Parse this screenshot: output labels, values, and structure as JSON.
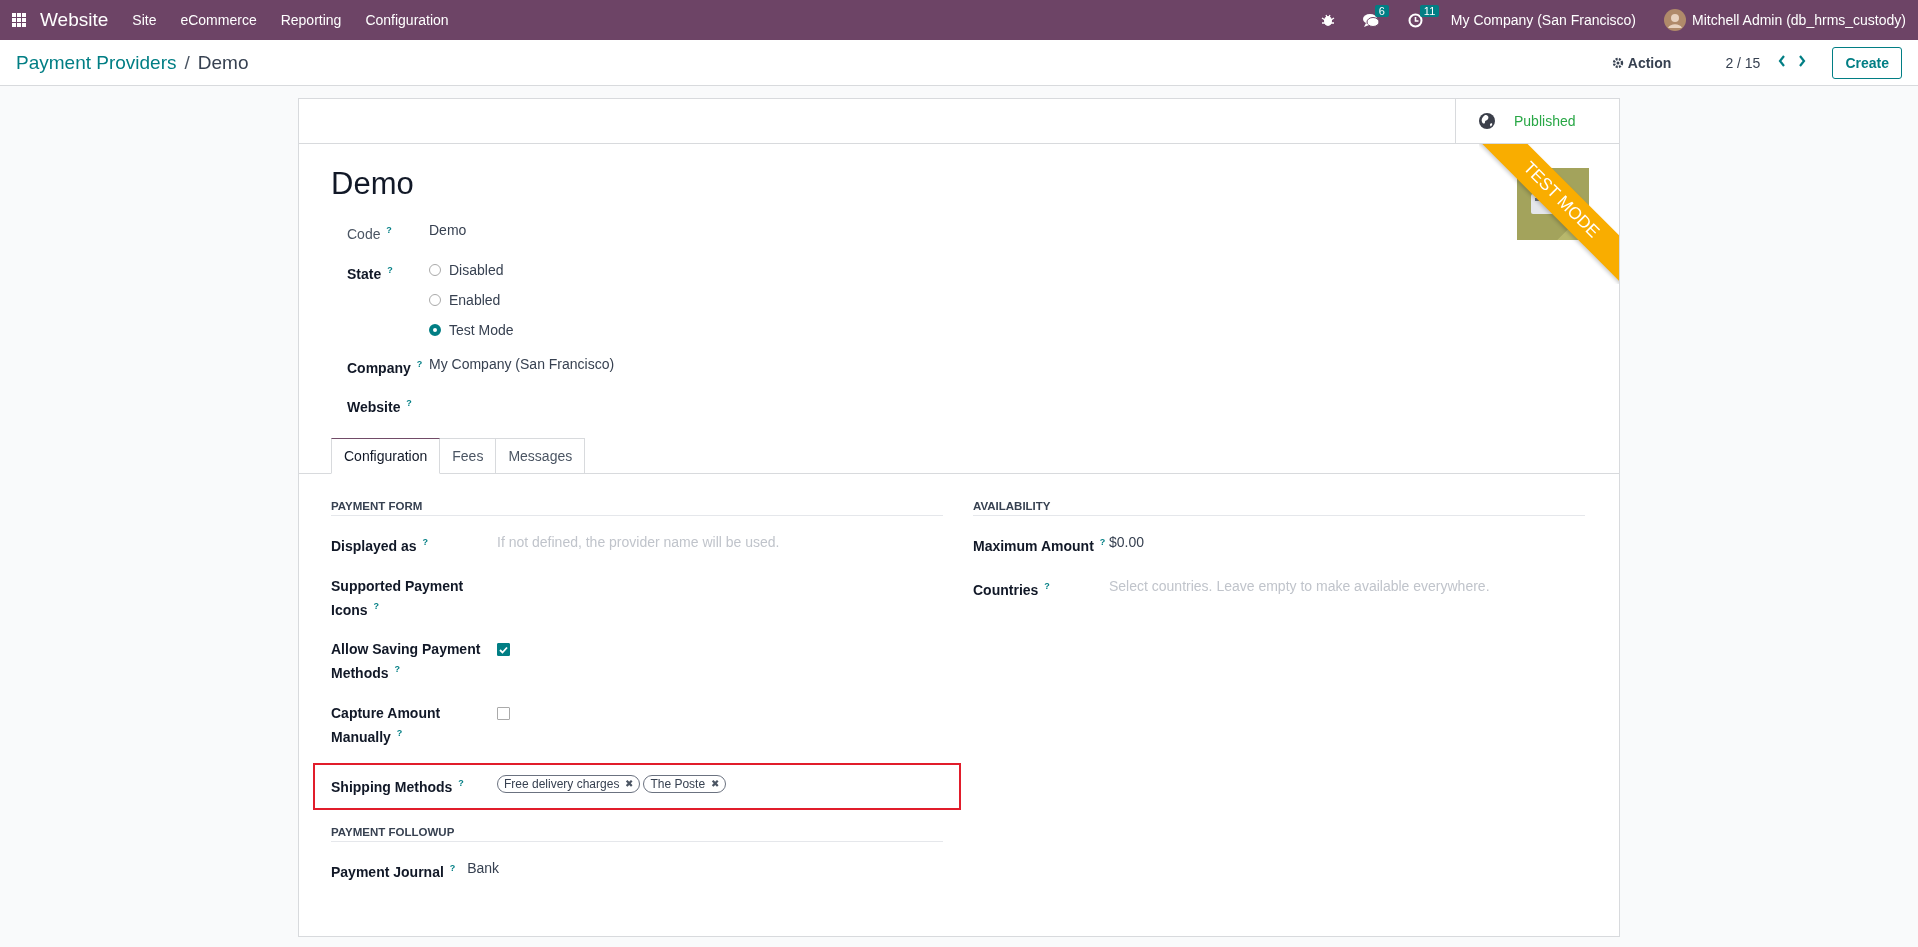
{
  "navbar": {
    "app_name": "Website",
    "menu": [
      "Site",
      "eCommerce",
      "Reporting",
      "Configuration"
    ],
    "messages_count": "6",
    "activities_count": "11",
    "company": "My Company (San Francisco)",
    "user": "Mitchell Admin (db_hrms_custody)"
  },
  "control_panel": {
    "breadcrumb_parent": "Payment Providers",
    "breadcrumb_separator": "/",
    "breadcrumb_current": "Demo",
    "action": "Action",
    "pager": "2 / 15",
    "create": "Create"
  },
  "status": {
    "label": "Published"
  },
  "ribbon": "TEST MODE",
  "title": "Demo",
  "fields": [
    {
      "label": "Code $^{?}$",
      "kind": "text",
      "value": "Demo",
      "muted": true
    },
    {
      "label": "State $^{?}$",
      "kind": "radio",
      "options": [
        {
          "label": "Disabled",
          "selected": false
        },
        {
          "label": "Enabled",
          "selected": false
        },
        {
          "label": "Test Mode",
          "selected": true
        }
      ]
    },
    {
      "label": "Company $^{?}$",
      "kind": "text",
      "value": "My Company (San Francisco)"
    },
    {
      "label": "Website $^{?}$",
      "kind": "text"
    }
  ],
  "tabs": [
    {
      "label": "Configuration",
      "selected": true
    },
    {
      "label": "Fees",
      "selected": false
    },
    {
      "label": "Messages",
      "selected": false
    }
  ],
  "left_groups": [
    {
      "title": "PAYMENT FORM",
      "fields": [
        {
          "label": "Displayed as $^{?}$",
          "kind": "text",
          "placeholder": "If not defined, the provider name will be used."
        },
        {
          "label": "Supported Payment Icons $^{?}$",
          "kind": "text"
        },
        {
          "label": "Allow Saving Payment Methods $^{?}$",
          "kind": "checkbox",
          "checked": true
        },
        {
          "label": "Capture Amount Manually $^{?}$",
          "kind": "checkbox",
          "checked": false
        },
        {
          "label": "Shipping Methods $^{?}$",
          "kind": "tags",
          "highlighted": true,
          "tags": [
            "Free delivery charges",
            "The Poste"
          ],
          "remove_glyph": "✖"
        }
      ]
    },
    {
      "title": "PAYMENT FOLLOWUP",
      "fields": [
        {
          "label": "Payment Journal $^{?}$",
          "kind": "text",
          "value": "Bank",
          "inline": true
        }
      ]
    }
  ],
  "right_groups": [
    {
      "title": "AVAILABILITY",
      "fields": [
        {
          "label": "Maximum Amount $^{?}$",
          "kind": "text",
          "value": "$0.00"
        },
        {
          "label": "Countries $^{?}$",
          "kind": "text",
          "placeholder": "Select countries. Leave empty to make available everywhere."
        }
      ]
    }
  ]
}
